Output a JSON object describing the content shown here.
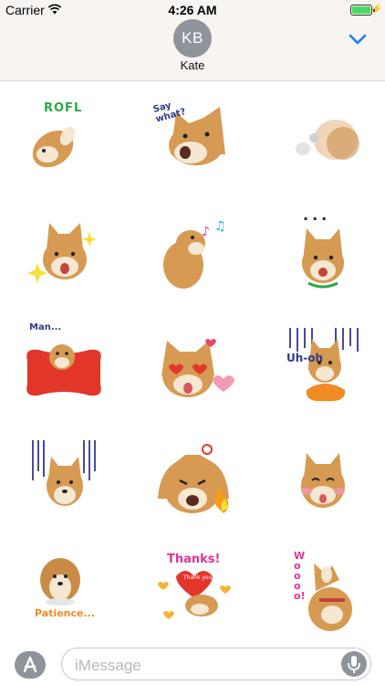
{
  "status_bar": {
    "carrier": "Carrier",
    "time": "4:26 AM"
  },
  "contact": {
    "initials": "KB",
    "name": "Kate"
  },
  "stickers": [
    {
      "caption": "ROFL"
    },
    {
      "caption": "Say what?"
    },
    {
      "caption": ""
    },
    {
      "caption": ""
    },
    {
      "caption": ""
    },
    {
      "caption": "..."
    },
    {
      "caption": "Man..."
    },
    {
      "caption": ""
    },
    {
      "caption": "Uh-oh"
    },
    {
      "caption": ""
    },
    {
      "caption": ""
    },
    {
      "caption": ""
    },
    {
      "caption": "Patience..."
    },
    {
      "caption": "Thanks!"
    },
    {
      "caption": "Woooo!"
    }
  ],
  "sticker_extra": {
    "thank_you_heart": "Thank you!"
  },
  "composer": {
    "placeholder": "iMessage"
  },
  "colors": {
    "accent": "#1a7cf5",
    "avatar": "#8e939c",
    "fur": "#d79a52",
    "fur_light": "#f6e7d2",
    "nose": "#222222"
  }
}
